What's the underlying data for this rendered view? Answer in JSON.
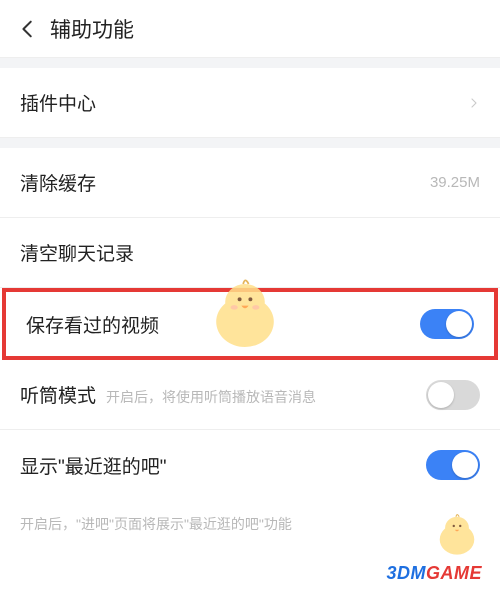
{
  "header": {
    "title": "辅助功能"
  },
  "rows": {
    "pluginCenter": {
      "label": "插件中心"
    },
    "clearCache": {
      "label": "清除缓存",
      "value": "39.25M"
    },
    "clearChat": {
      "label": "清空聊天记录"
    },
    "saveVideos": {
      "label": "保存看过的视频",
      "on": true
    },
    "earpieceMode": {
      "label": "听筒模式",
      "sub": "开启后，将使用听筒播放语音消息",
      "on": false
    },
    "showRecent": {
      "label": "显示\"最近逛的吧\"",
      "on": true
    }
  },
  "note": "开启后，\"进吧\"页面将展示\"最近逛的吧\"功能",
  "watermark": {
    "brand_part1": "3DM",
    "brand_part2": "GAME"
  }
}
